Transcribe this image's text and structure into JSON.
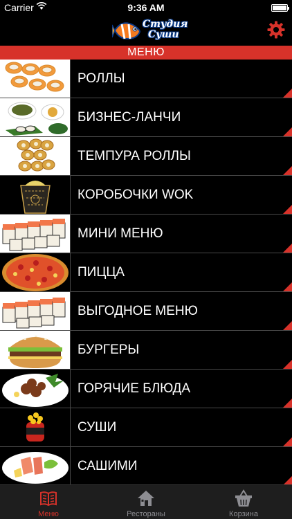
{
  "status_bar": {
    "carrier": "Carrier",
    "time": "9:36 AM"
  },
  "nav": {
    "logo_line1": "Студия",
    "logo_line2": "Суши",
    "settings_icon": "gear-icon"
  },
  "section_header": "МЕНЮ",
  "menu": {
    "items": [
      {
        "label": "РОЛЛЫ",
        "image": "rolls"
      },
      {
        "label": "БИЗНЕС-ЛАНЧИ",
        "image": "business-lunch"
      },
      {
        "label": "ТЕМПУРА РОЛЛЫ",
        "image": "tempura-rolls"
      },
      {
        "label": "КОРОБОЧКИ WOK",
        "image": "wok-box"
      },
      {
        "label": "МИНИ МЕНЮ",
        "image": "mini-menu"
      },
      {
        "label": "ПИЦЦА",
        "image": "pizza"
      },
      {
        "label": "ВЫГОДНОЕ МЕНЮ",
        "image": "value-menu"
      },
      {
        "label": "БУРГЕРЫ",
        "image": "burger"
      },
      {
        "label": "ГОРЯЧИЕ БЛЮДА",
        "image": "hot-dishes"
      },
      {
        "label": "СУШИ",
        "image": "sushi"
      },
      {
        "label": "САШИМИ",
        "image": "sashimi"
      }
    ]
  },
  "tabs": [
    {
      "label": "Меню",
      "icon": "book-icon",
      "active": true
    },
    {
      "label": "Рестораны",
      "icon": "house-icon",
      "active": false
    },
    {
      "label": "Корзина",
      "icon": "basket-icon",
      "active": false
    }
  ],
  "colors": {
    "accent": "#d7322a",
    "background": "#000000",
    "tab_bar": "#1e1e1e",
    "inactive": "#8e8e93"
  }
}
